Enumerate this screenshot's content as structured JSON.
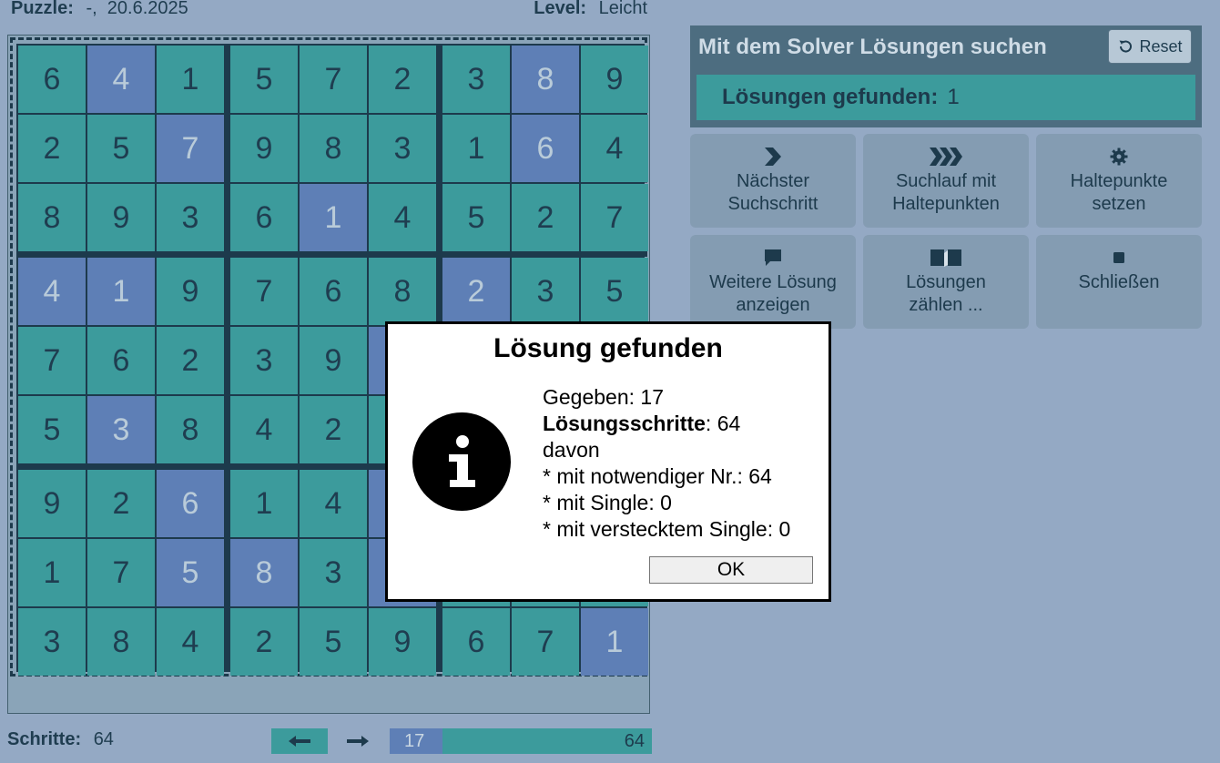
{
  "header": {
    "puzzle_label": "Puzzle:",
    "puzzle_value": "-,  20.6.2025",
    "level_label": "Level:",
    "level_value": "Leicht"
  },
  "grid": [
    [
      6,
      4,
      1,
      5,
      7,
      2,
      3,
      8,
      9
    ],
    [
      2,
      5,
      7,
      9,
      8,
      3,
      1,
      6,
      4
    ],
    [
      8,
      9,
      3,
      6,
      1,
      4,
      5,
      2,
      7
    ],
    [
      4,
      1,
      9,
      7,
      6,
      8,
      2,
      3,
      5
    ],
    [
      7,
      6,
      2,
      3,
      9,
      "",
      "",
      "",
      ""
    ],
    [
      5,
      3,
      8,
      4,
      2,
      "",
      "",
      "",
      ""
    ],
    [
      9,
      2,
      6,
      1,
      4,
      "",
      "",
      "",
      ""
    ],
    [
      1,
      7,
      5,
      8,
      3,
      "",
      "",
      "",
      ""
    ],
    [
      3,
      8,
      4,
      2,
      5,
      9,
      6,
      7,
      1
    ]
  ],
  "givens": [
    [
      0,
      1
    ],
    [
      0,
      7
    ],
    [
      1,
      2
    ],
    [
      1,
      7
    ],
    [
      2,
      4
    ],
    [
      3,
      0
    ],
    [
      3,
      1
    ],
    [
      3,
      6
    ],
    [
      5,
      1
    ],
    [
      6,
      2
    ],
    [
      7,
      2
    ],
    [
      7,
      3
    ],
    [
      8,
      8
    ],
    [
      4,
      5
    ],
    [
      6,
      5
    ],
    [
      7,
      5
    ]
  ],
  "bottom": {
    "steps_label": "Schritte:",
    "steps_value": "64",
    "progress_start": "17",
    "progress_end": "64",
    "progress_fraction": 0.2
  },
  "solver": {
    "title": "Mit dem Solver Lösungen suchen",
    "reset_label": "Reset",
    "found_label": "Lösungen gefunden:",
    "found_value": "1"
  },
  "actions": [
    {
      "line1": "Nächster",
      "line2": "Suchschritt",
      "icon": "chevron-right-icon"
    },
    {
      "line1": "Suchlauf mit",
      "line2": "Haltepunkten",
      "icon": "triple-chevron-icon"
    },
    {
      "line1": "Haltepunkte",
      "line2": "setzen",
      "icon": "gear-icon"
    },
    {
      "line1": "Weitere Lösung",
      "line2": "anzeigen",
      "icon": "flag-icon"
    },
    {
      "line1": "Lösungen",
      "line2": "zählen ...",
      "icon": "book-icon"
    },
    {
      "line1": "Schließen",
      "line2": "",
      "icon": "stop-icon"
    }
  ],
  "dialog": {
    "title": "Lösung gefunden",
    "given_label": "Gegeben:",
    "given_value": "17",
    "steps_label": "Lösungsschritte",
    "steps_value": ": 64",
    "davon": "davon",
    "line_necessary": "* mit notwendiger Nr.: 64",
    "line_single": "* mit Single: 0",
    "line_hidden_single": "* mit verstecktem Single: 0",
    "ok_label": "OK"
  },
  "colors": {
    "background": "#94a9c4",
    "cell": "#3c9b9c",
    "given_cell": "#5e7fb6",
    "grid_line": "#1d3a4c"
  }
}
